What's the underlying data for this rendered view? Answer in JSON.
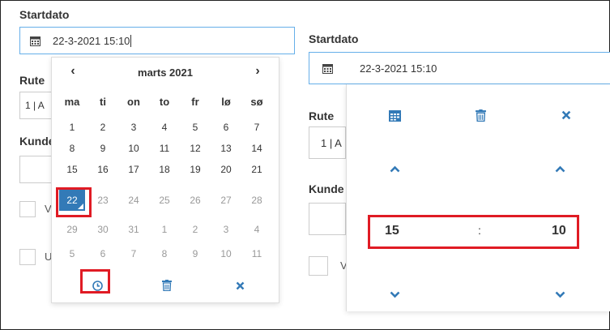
{
  "left": {
    "startdato_label": "Startdato",
    "startdato_value": "22-3-2021 15:10",
    "rute_label": "Rute",
    "rute_value": "1 | A",
    "kunde_label": "Kunde",
    "checkbox1_label": "V",
    "checkbox2_label": "U"
  },
  "calendar": {
    "month_title": "marts 2021",
    "prev_icon": "chevron-left",
    "next_icon": "chevron-right",
    "weekdays": [
      "ma",
      "ti",
      "on",
      "to",
      "fr",
      "lø",
      "sø"
    ],
    "weeks": [
      [
        "1",
        "2",
        "3",
        "4",
        "5",
        "6",
        "7"
      ],
      [
        "8",
        "9",
        "10",
        "11",
        "12",
        "13",
        "14"
      ],
      [
        "15",
        "16",
        "17",
        "18",
        "19",
        "20",
        "21"
      ],
      [
        "22",
        "23",
        "24",
        "25",
        "26",
        "27",
        "28"
      ],
      [
        "29",
        "30",
        "31",
        "1",
        "2",
        "3",
        "4"
      ],
      [
        "5",
        "6",
        "7",
        "8",
        "9",
        "10",
        "11"
      ]
    ],
    "selected_day": "22",
    "footer_icons": [
      "clock-icon",
      "trash-icon",
      "close-icon"
    ]
  },
  "right": {
    "startdato_label": "Startdato",
    "startdato_value": "22-3-2021 15:10",
    "rute_label": "Rute",
    "rute_value": "1 | A",
    "kunde_label": "Kunde",
    "checkbox_label": "V"
  },
  "timepicker": {
    "hours": "15",
    "separator": ":",
    "minutes": "10",
    "top_icons": [
      "calendar-icon",
      "trash-icon",
      "close-icon"
    ]
  },
  "colors": {
    "accent": "#337ab7",
    "highlight": "#e01b24",
    "border": "#cccccc"
  }
}
